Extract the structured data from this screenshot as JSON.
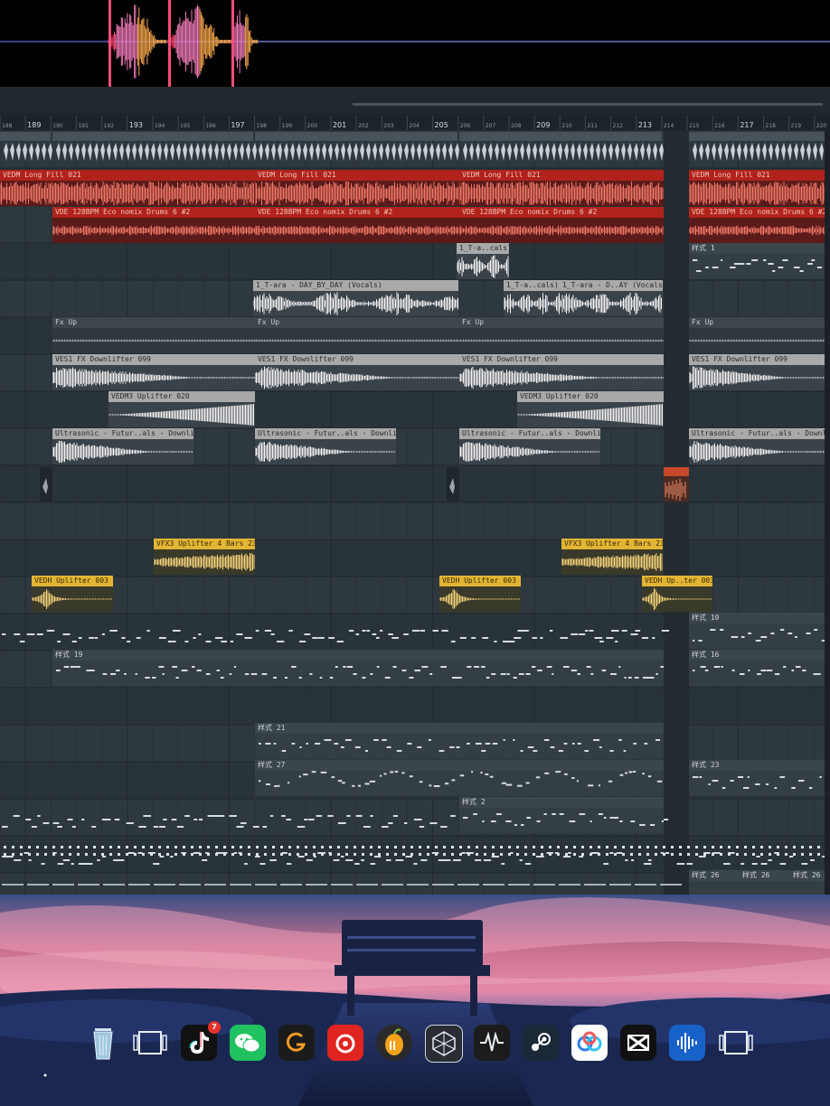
{
  "ruler": {
    "bars": [
      "188",
      "189",
      "190",
      "191",
      "192",
      "193",
      "194",
      "195",
      "196",
      "197",
      "198",
      "199",
      "200",
      "201",
      "202",
      "203",
      "204",
      "205",
      "206",
      "207",
      "208",
      "209",
      "210",
      "211",
      "212",
      "213",
      "214",
      "215",
      "216",
      "217",
      "218",
      "219",
      "220"
    ],
    "major": [
      "189",
      "193",
      "197",
      "201",
      "205",
      "209",
      "213",
      "217"
    ]
  },
  "clips": {
    "fill1": "VEDM Long Fill 021",
    "fill2": "VEDM Long Fill 021",
    "fill3": "VEDM Long Fill 021",
    "fill4": "VEDM Long Fill 021",
    "drums1": "VDE 128BPM Eco nomix Drums 6 #2",
    "drums2": "VDE 128BPM Eco nomix Drums 6 #2",
    "drums3": "VDE 128BPM Eco nomix Drums 6 #2",
    "drums4": "VDE 128BPM Eco nomix Drums 6 #2",
    "vocal_small": "1_T-a..cals)",
    "pattern1": "样式 1",
    "vocal_main": "1_T-ara - DAY_BY_DAY (Vocals)",
    "vocal_b": "1_T-a..cals)",
    "vocal_c": "1_T-ara - D..AY (Vocals)",
    "fxup1": "Fx Up",
    "fxup2": "Fx Up",
    "fxup3": "Fx Up",
    "fxup4": "Fx Up",
    "down1": "VES1 FX Downlifter 099",
    "down2": "VES1 FX Downlifter 099",
    "down3": "VES1 FX Downlifter 099",
    "down4": "VES1 FX Downlifter 099",
    "upl1": "VEDM3 Uplifter 020",
    "upl2": "VEDM3 Uplifter 020",
    "ultra1": "Ultrasonic - Futur..als - Downlifter 13",
    "ultra2": "Ultrasonic - Futur..als - Downlifter 13",
    "ultra3": "Ultrasonic - Futur..als - Downlifter 13",
    "ultra4": "Ultrasonic - Futur..als - Downlifter 13",
    "vfx1": "VFX3 Uplifter 4 Bars 23",
    "vfx2": "VFX3 Uplifter 4 Bars 23",
    "vedh1": "VEDH Uplifter 003",
    "vedh2": "VEDH Uplifter 003",
    "vedh3": "VEDH Up..ter 003",
    "pattern10": "样式 10",
    "pattern19": "样式 19",
    "pattern16": "样式 16",
    "pattern21": "样式 21",
    "pattern27": "样式 27",
    "pattern23": "样式 23",
    "pattern2": "样式 2",
    "pattern26a": "样式 26",
    "pattern26b": "样式 26",
    "pattern26c": "样式 26"
  },
  "dock": {
    "tiktok_badge": "7",
    "items": [
      "recycle-bin",
      "task-view",
      "tiktok",
      "wechat",
      "app-g",
      "netease-music",
      "fl-studio",
      "app-hex",
      "app-waveform",
      "steam",
      "baidu-netdisk",
      "capcut",
      "app-audio",
      "task-view-2"
    ]
  },
  "colors": {
    "playlist_bg": "#2c363d",
    "red_clip": "#b0231c",
    "gray_clip": "#a9a9a9",
    "yellow_clip": "#e2b534",
    "orange_clip": "#c8472a"
  }
}
